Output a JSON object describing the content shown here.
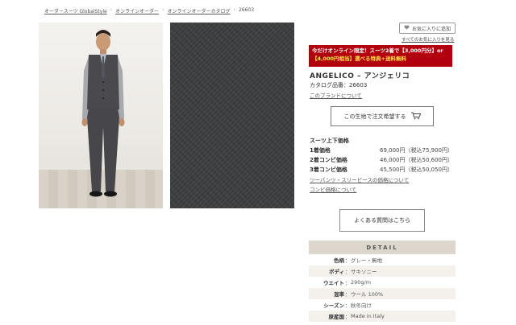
{
  "breadcrumb": {
    "items": [
      "オーダースーツ GlobalStyle",
      "オンラインオーダー",
      "オンラインオーダーカタログ",
      "26603"
    ],
    "separator": "›"
  },
  "favorites": {
    "add_label": "お気に入りに追加",
    "list_link": "すべてのお気に入りを見る"
  },
  "promo": {
    "line1": "今だけオンライン限定！スーツ2着で【3,000円分】or",
    "line2": "【4,000円相当】選べる特典+送料無料"
  },
  "product": {
    "title": "ANGELICO – アンジェリコ",
    "catalog": "カタログ品番：26603",
    "brand_link": "このブランドについて"
  },
  "order_button": {
    "label": "この生地で注文希望する",
    "icon": "cart-icon"
  },
  "prices": {
    "heading": "スーツ上下価格",
    "rows": [
      {
        "label": "1着価格",
        "value": "69,000円（税込75,900円）"
      },
      {
        "label": "2着コンビ価格",
        "value": "46,000円（税込50,600円）"
      },
      {
        "label": "3着コンビ価格",
        "value": "45,500円（税込50,050円）"
      }
    ],
    "links": [
      "ツーパンツ・スリーピースの価格について",
      "コンビ価格について"
    ]
  },
  "faq_button": {
    "label": "よくある質問はこちら"
  },
  "detail": {
    "heading": "DETAIL",
    "rows": [
      {
        "key": "色柄",
        "value": "グレー・無地"
      },
      {
        "key": "ボディ",
        "value": "サキソニー"
      },
      {
        "key": "ウエイト",
        "value": "290g/m"
      },
      {
        "key": "混率",
        "value": "ウール 100%"
      },
      {
        "key": "シーズン",
        "value": "秋冬向け"
      },
      {
        "key": "原産国",
        "value": "Made in Italy"
      }
    ]
  },
  "colors": {
    "promo_bg": "#b3000e",
    "promo_highlight": "#ffe04a",
    "detail_head_bg": "#ddd6cd",
    "fabric": "#3c3d3f"
  }
}
